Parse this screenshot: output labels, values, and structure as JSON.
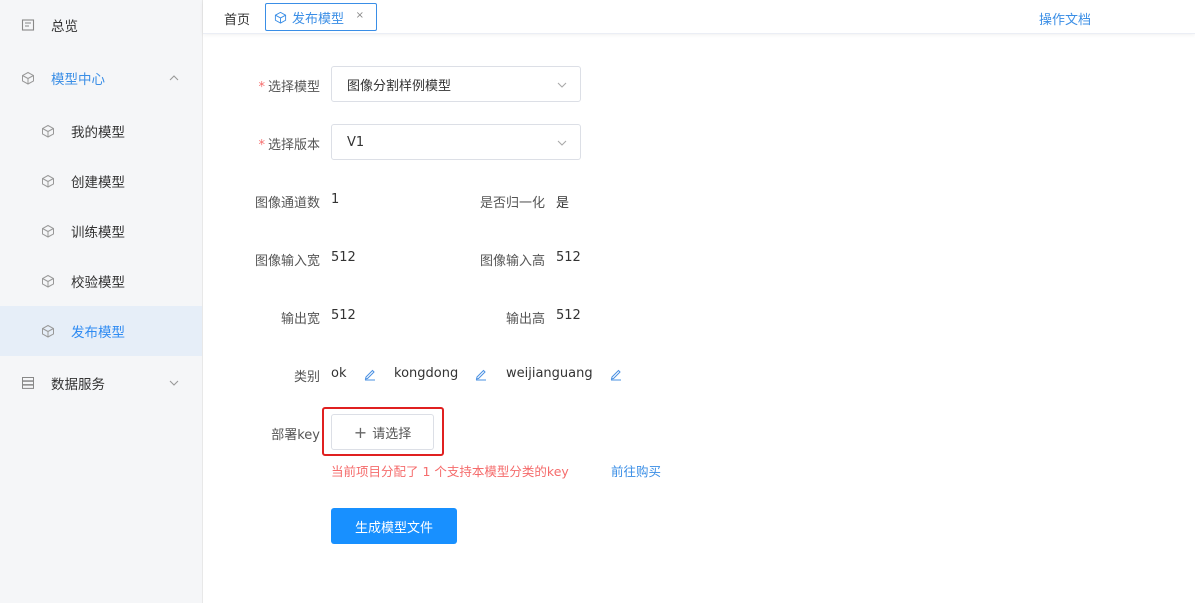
{
  "sidebar": {
    "items": [
      {
        "label": "总览",
        "icon": "overview-icon"
      },
      {
        "label": "模型中心",
        "icon": "cube-icon"
      },
      {
        "label": "我的模型",
        "icon": "cube-icon"
      },
      {
        "label": "创建模型",
        "icon": "cube-icon"
      },
      {
        "label": "训练模型",
        "icon": "cube-icon"
      },
      {
        "label": "校验模型",
        "icon": "cube-icon"
      },
      {
        "label": "发布模型",
        "icon": "cube-icon"
      },
      {
        "label": "数据服务",
        "icon": "database-icon"
      }
    ]
  },
  "topbar": {
    "home_tab": "首页",
    "active_tab": "发布模型",
    "close_symbol": "×",
    "docs_link": "操作文档"
  },
  "form": {
    "model_label": "选择模型",
    "model_value": "图像分割样例模型",
    "version_label": "选择版本",
    "version_value": "V1",
    "channels_label": "图像通道数",
    "channels_value": "1",
    "normalize_label": "是否归一化",
    "normalize_value": "是",
    "input_width_label": "图像输入宽",
    "input_width_value": "512",
    "input_height_label": "图像输入高",
    "input_height_value": "512",
    "output_width_label": "输出宽",
    "output_width_value": "512",
    "output_height_label": "输出高",
    "output_height_value": "512",
    "category_label": "类别",
    "categories": [
      "ok",
      "kongdong",
      "weijianguang"
    ],
    "key_label": "部署key",
    "choose_button": "请选择",
    "choose_plus": "+",
    "key_notice": "当前项目分配了 1 个支持本模型分类的key",
    "buy_link": "前往购买",
    "generate_button": "生成模型文件"
  },
  "colors": {
    "accent": "#3a8ee6",
    "primary_button": "#1890ff",
    "error": "#f56c6c",
    "highlight_box": "#e02020"
  }
}
